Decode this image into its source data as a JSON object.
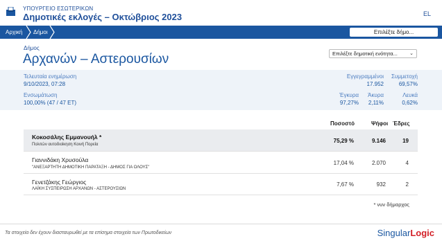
{
  "header": {
    "ministry": "ΥΠΟΥΡΓΕΙΟ ΕΣΩΤΕΡΙΚΩΝ",
    "title": "Δημοτικές εκλογές – Οκτώβριος 2023",
    "language": "EL",
    "logo_icon": "ballot-box-icon"
  },
  "breadcrumbs": [
    "Αρχική",
    "Δήμοι"
  ],
  "nav_search_label": "Επιλέξτε δήμο...",
  "municipality": {
    "label": "Δήμος",
    "name": "Αρχανών – Αστερουσίων",
    "unit_select_label": "Επιλέξτε δημοτική ενότητα...",
    "chevron_icon": "chevron-down-icon"
  },
  "stats": {
    "last_update_label": "Τελευταία ενημέρωση",
    "last_update_value": "9/10/2023, 07:28",
    "integration_label": "Ενσωμάτωση",
    "integration_value": "100,00% (47 / 47 ΕΤ)",
    "registered_label": "Εγγεγραμμένοι",
    "registered_value": "17.952",
    "turnout_label": "Συμμετοχή",
    "turnout_value": "69,57%",
    "valid_label": "Έγκυρα",
    "valid_value": "97,27%",
    "invalid_label": "Άκυρα",
    "invalid_value": "2,11%",
    "blank_label": "Λευκά",
    "blank_value": "0,62%"
  },
  "table": {
    "headers": {
      "percent": "Ποσοστό",
      "votes": "Ψήφοι",
      "seats": "Έδρες"
    },
    "rows": [
      {
        "name": "Κοκοσάλης Εμμανουήλ *",
        "party": "Πολιτών αυτοδιοίκηση Κοινή Πορεία",
        "percent": "75,29 %",
        "votes": "9.146",
        "seats": "19"
      },
      {
        "name": "Γιαννιδάκη Χρυσούλα",
        "party": "\"ΑΝΕΞΑΡΤΗΤΗ ΔΗΜΟΤΙΚΗ ΠΑΡΑΤΑΞΗ - ΔΗΜΟΣ ΓΙΑ ΟΛΟΥΣ\"",
        "percent": "17,04 %",
        "votes": "2.070",
        "seats": "4"
      },
      {
        "name": "Γενετζάκης Γεώργιος",
        "party": "ΛΑΪΚΗ ΣΥΣΠΕΙΡΩΣΗ ΑΡΧΑΝΩΝ - ΑΣΤΕΡΟΥΣΙΩΝ",
        "percent": "7,67 %",
        "votes": "932",
        "seats": "2"
      }
    ],
    "footnote": "* νυν δήμαρχος"
  },
  "footer": {
    "disclaimer": "Τα στοιχεία δεν έχουν διασταυρωθεί με τα επίσημα στοιχεία των Πρωτοδικείων",
    "brand_main": "Singular",
    "brand_accent": "Logic"
  },
  "colors": {
    "primary": "#1a56a0",
    "accent_red": "#d32027",
    "stats_bg": "#eef3f9",
    "winner_bg": "#eaecef"
  }
}
